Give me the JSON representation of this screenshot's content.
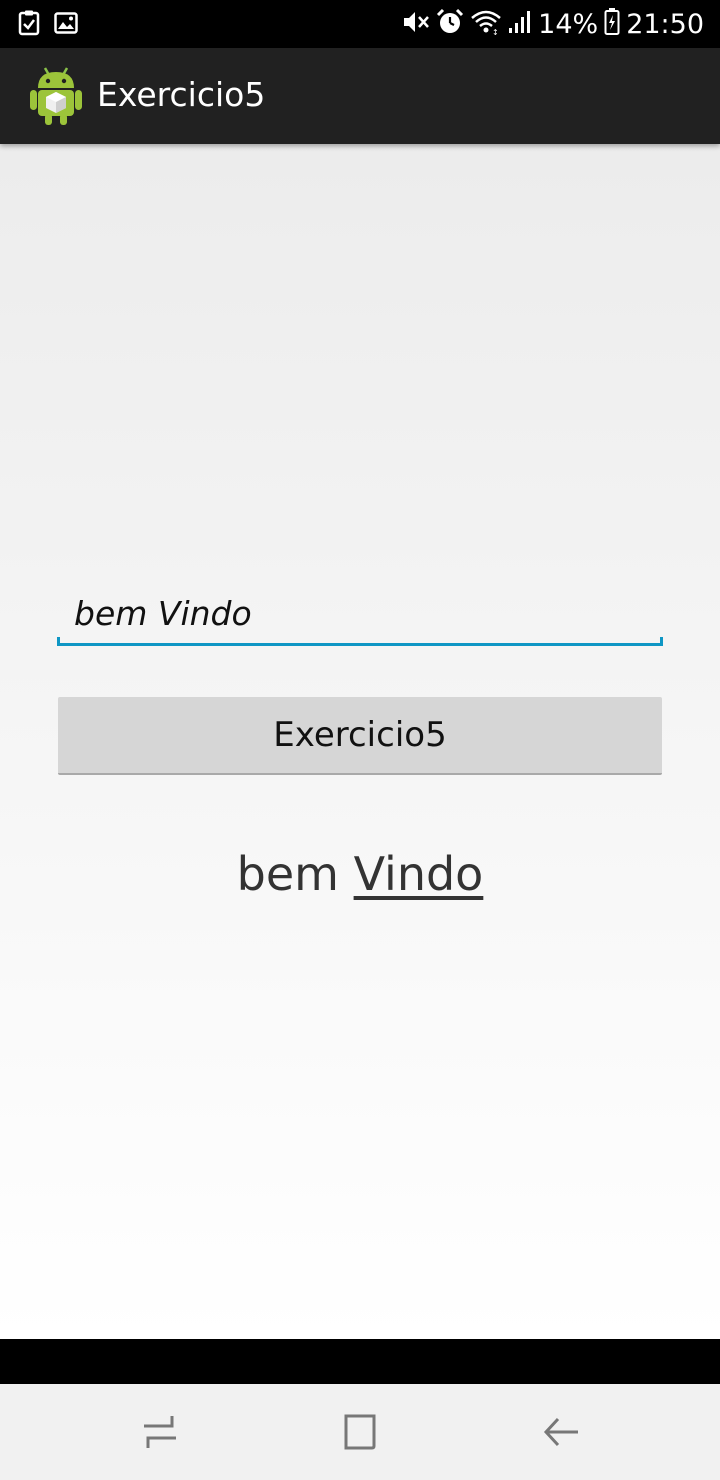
{
  "status_bar": {
    "battery_percent": "14%",
    "time": "21:50",
    "left_icons": [
      "task-check-icon",
      "image-icon"
    ],
    "right_icons": [
      "mute-icon",
      "alarm-icon",
      "wifi-icon",
      "signal-icon",
      "battery-icon"
    ]
  },
  "action_bar": {
    "title": "Exercicio5",
    "icon": "android-app-icon"
  },
  "form": {
    "input_value": "bem Vindo",
    "button_label": "Exercicio5",
    "result_word1": "bem ",
    "result_word2": "Vindo"
  },
  "nav_bar": {
    "buttons": [
      "recent-apps-icon",
      "home-icon",
      "back-icon"
    ]
  },
  "colors": {
    "accent": "#0e96c4",
    "action_bar": "#212121",
    "button": "#d6d6d6"
  }
}
